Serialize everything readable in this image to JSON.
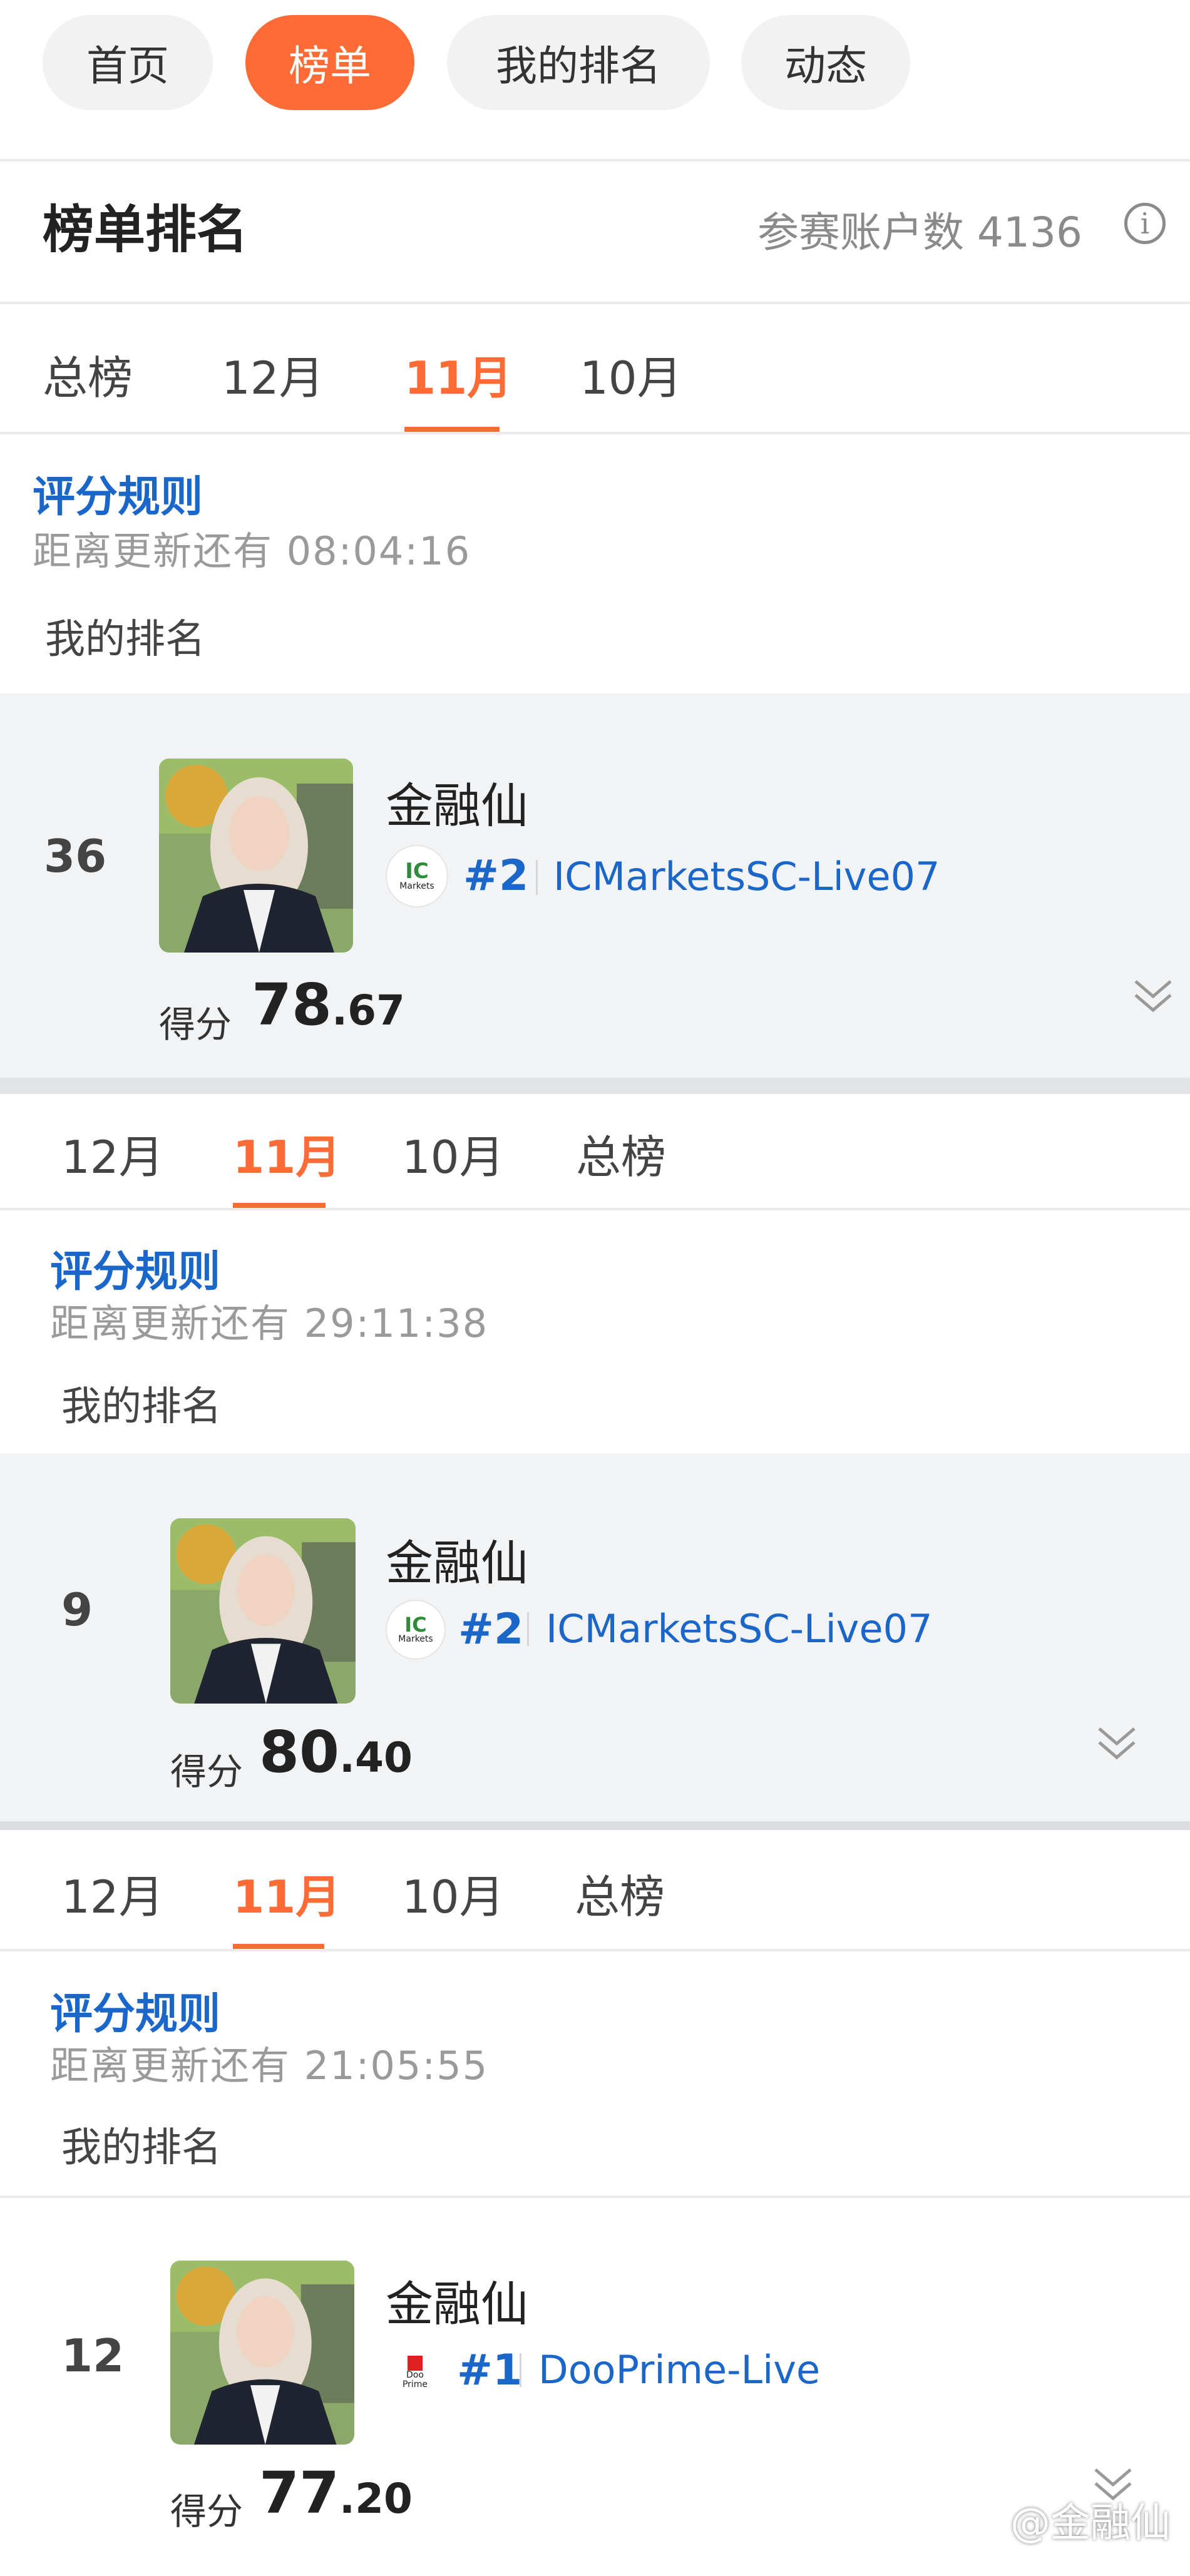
{
  "top_nav": [
    "首页",
    "榜单",
    "我的排名",
    "动态"
  ],
  "header": {
    "title": "榜单排名",
    "count_text": "参赛账户数 4136",
    "info_glyph": "i"
  },
  "blocks": [
    {
      "tabs": [
        "总榜",
        "12月",
        "11月",
        "10月"
      ],
      "active_tab": "11月",
      "rule": "评分规则",
      "countdown": "距离更新还有 08:04:16",
      "my_rank_label": "我的排名",
      "rank": "36",
      "name": "金融仙",
      "broker_pos": "#2",
      "broker_logo": [
        "IC",
        "Markets"
      ],
      "account": "ICMarketsSC-Live07",
      "score_label": "得分",
      "score_int": "78",
      "score_dec": ".67"
    },
    {
      "tabs": [
        "12月",
        "11月",
        "10月",
        "总榜"
      ],
      "active_tab": "11月",
      "rule": "评分规则",
      "countdown": "距离更新还有 29:11:38",
      "my_rank_label": "我的排名",
      "rank": "9",
      "name": "金融仙",
      "broker_pos": "#2",
      "broker_logo": [
        "IC",
        "Markets"
      ],
      "account": "ICMarketsSC-Live07",
      "score_label": "得分",
      "score_int": "80",
      "score_dec": ".40"
    },
    {
      "tabs": [
        "12月",
        "11月",
        "10月",
        "总榜"
      ],
      "active_tab": "11月",
      "rule": "评分规则",
      "countdown": "距离更新还有 21:05:55",
      "my_rank_label": "我的排名",
      "rank": "12",
      "name": "金融仙",
      "broker_pos": "#1",
      "broker_logo": [
        "Doo",
        "Prime"
      ],
      "account": "DooPrime-Live",
      "score_label": "得分",
      "score_int": "77",
      "score_dec": ".20"
    }
  ],
  "watermark": "@金融仙",
  "colors": {
    "accent": "#ff6b35",
    "link": "#1b66c9",
    "band": "#f2f3f5"
  },
  "icons": {
    "info": "info-circle-icon",
    "expand": "double-chevron-down-icon",
    "watermark_logo": "zhihu-logo-icon"
  }
}
